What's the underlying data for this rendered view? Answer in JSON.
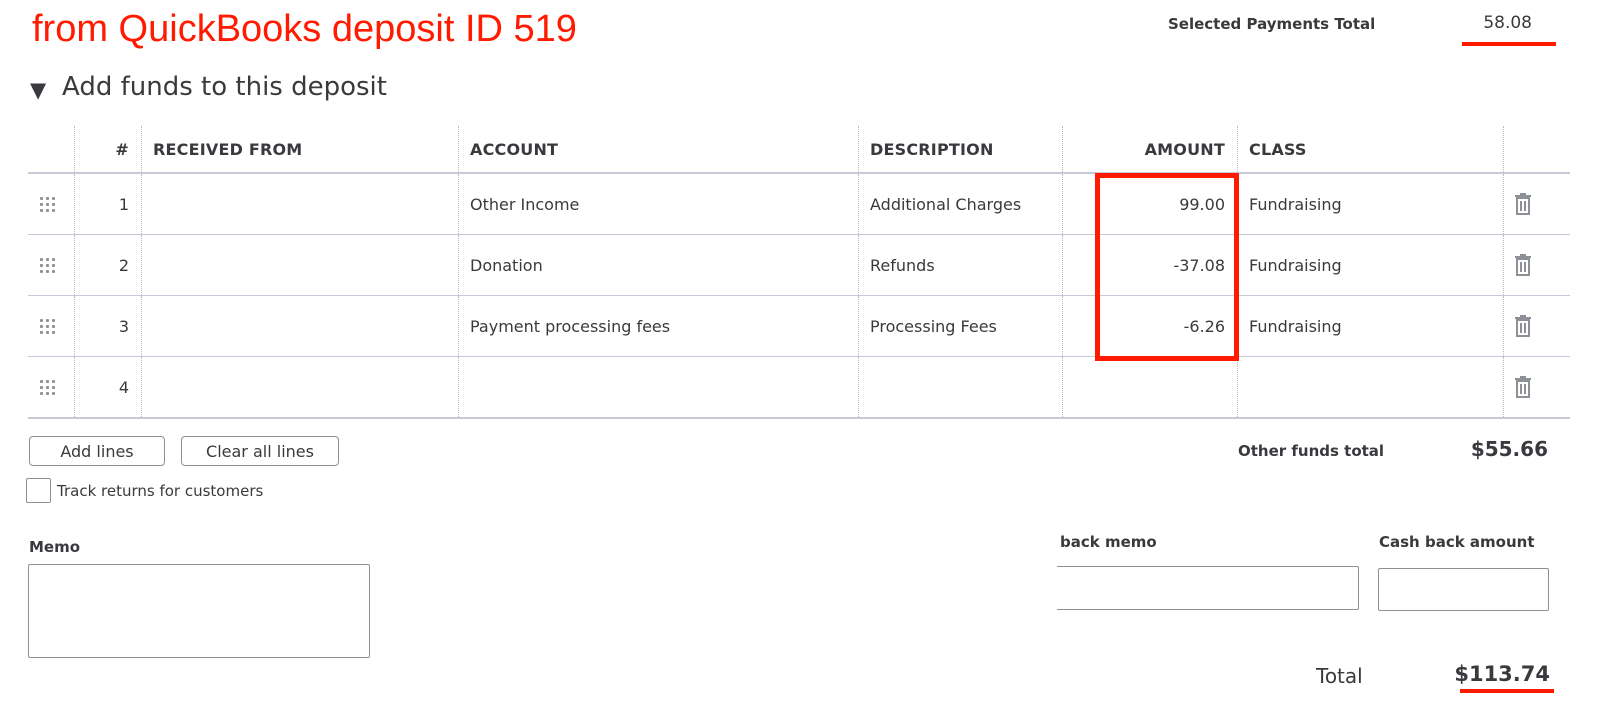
{
  "annotation": {
    "title": "from QuickBooks deposit ID 519",
    "accent": "#ff1a00"
  },
  "selected_payments": {
    "label": "Selected Payments Total",
    "value": "58.08"
  },
  "section": {
    "toggle_icon": "triangle-down-icon",
    "title": "Add funds to this deposit"
  },
  "table": {
    "headers": {
      "num": "#",
      "received_from": "RECEIVED FROM",
      "account": "ACCOUNT",
      "description": "DESCRIPTION",
      "amount": "AMOUNT",
      "class": "CLASS"
    },
    "rows": [
      {
        "num": "1",
        "received_from": "",
        "account": "Other Income",
        "description": "Additional Charges",
        "amount": "99.00",
        "class": "Fundraising"
      },
      {
        "num": "2",
        "received_from": "",
        "account": "Donation",
        "description": "Refunds",
        "amount": "-37.08",
        "class": "Fundraising"
      },
      {
        "num": "3",
        "received_from": "",
        "account": "Payment processing fees",
        "description": "Processing Fees",
        "amount": "-6.26",
        "class": "Fundraising"
      },
      {
        "num": "4",
        "received_from": "",
        "account": "",
        "description": "",
        "amount": "",
        "class": ""
      }
    ],
    "row_icons": {
      "drag": "drag-handle-icon",
      "delete": "trash-icon"
    }
  },
  "buttons": {
    "add_lines": "Add lines",
    "clear_all_lines": "Clear all lines"
  },
  "track_returns": {
    "label": "Track returns for customers",
    "checked": false
  },
  "other_funds": {
    "label": "Other funds total",
    "value": "$55.66"
  },
  "memo": {
    "label": "Memo",
    "value": ""
  },
  "cash_back_memo": {
    "label": "back memo",
    "value": ""
  },
  "cash_back_amount": {
    "label": "Cash back amount",
    "value": ""
  },
  "total": {
    "label": "Total",
    "value": "$113.74"
  }
}
